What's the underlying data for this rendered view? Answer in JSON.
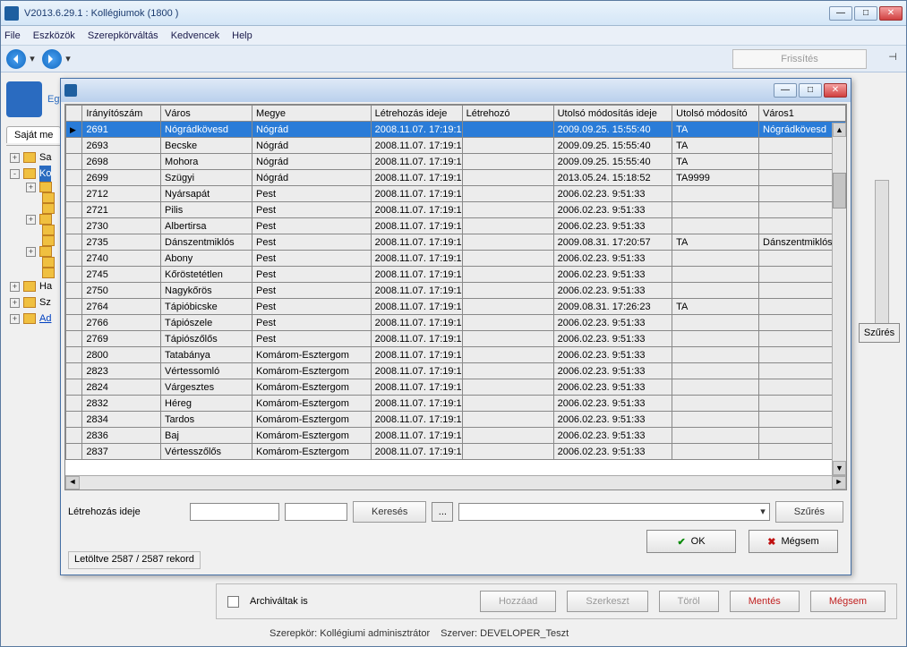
{
  "window": {
    "title": "V2013.6.29.1 : Kollégiumok (1800  )"
  },
  "menu": {
    "items": [
      "File",
      "Eszközök",
      "Szerepkörváltás",
      "Kedvencek",
      "Help"
    ]
  },
  "toolbar": {
    "refresh": "Frissítés"
  },
  "leftpane": {
    "logo_sub": "Egységes",
    "tab": "Saját me",
    "nodes": [
      "Sa",
      "Ko",
      "Ha",
      "Sz",
      "Ad"
    ]
  },
  "right": {
    "filter": "Szűrés"
  },
  "dialog": {
    "columns": [
      "Irányítószám",
      "Város",
      "Megye",
      "Létrehozás ideje",
      "Létrehozó",
      "Utolsó módosítás ideje",
      "Utolsó módosító",
      "Város1"
    ],
    "rows": [
      {
        "zip": "2691",
        "city": "Nógrádkövesd",
        "county": "Nógrád",
        "created": "2008.11.07. 17:19:1",
        "creator": "",
        "modified": "2009.09.25. 15:55:40",
        "modifier": "TA",
        "city1": "Nógrádkövesd",
        "sel": true
      },
      {
        "zip": "2693",
        "city": "Becske",
        "county": "Nógrád",
        "created": "2008.11.07. 17:19:1",
        "creator": "",
        "modified": "2009.09.25. 15:55:40",
        "modifier": "TA",
        "city1": ""
      },
      {
        "zip": "2698",
        "city": "Mohora",
        "county": "Nógrád",
        "created": "2008.11.07. 17:19:1",
        "creator": "",
        "modified": "2009.09.25. 15:55:40",
        "modifier": "TA",
        "city1": ""
      },
      {
        "zip": "2699",
        "city": "Szügyi",
        "county": "Nógrád",
        "created": "2008.11.07. 17:19:1",
        "creator": "",
        "modified": "2013.05.24. 15:18:52",
        "modifier": "TA9999",
        "city1": ""
      },
      {
        "zip": "2712",
        "city": "Nyársapát",
        "county": "Pest",
        "created": "2008.11.07. 17:19:1",
        "creator": "",
        "modified": "2006.02.23. 9:51:33",
        "modifier": "",
        "city1": ""
      },
      {
        "zip": "2721",
        "city": "Pilis",
        "county": "Pest",
        "created": "2008.11.07. 17:19:1",
        "creator": "",
        "modified": "2006.02.23. 9:51:33",
        "modifier": "",
        "city1": ""
      },
      {
        "zip": "2730",
        "city": "Albertirsa",
        "county": "Pest",
        "created": "2008.11.07. 17:19:1",
        "creator": "",
        "modified": "2006.02.23. 9:51:33",
        "modifier": "",
        "city1": ""
      },
      {
        "zip": "2735",
        "city": "Dánszentmiklós",
        "county": "Pest",
        "created": "2008.11.07. 17:19:1",
        "creator": "",
        "modified": "2009.08.31. 17:20:57",
        "modifier": "TA",
        "city1": "Dánszentmiklós"
      },
      {
        "zip": "2740",
        "city": "Abony",
        "county": "Pest",
        "created": "2008.11.07. 17:19:1",
        "creator": "",
        "modified": "2006.02.23. 9:51:33",
        "modifier": "",
        "city1": ""
      },
      {
        "zip": "2745",
        "city": "Kőröstetétlen",
        "county": "Pest",
        "created": "2008.11.07. 17:19:1",
        "creator": "",
        "modified": "2006.02.23. 9:51:33",
        "modifier": "",
        "city1": ""
      },
      {
        "zip": "2750",
        "city": "Nagykőrös",
        "county": "Pest",
        "created": "2008.11.07. 17:19:1",
        "creator": "",
        "modified": "2006.02.23. 9:51:33",
        "modifier": "",
        "city1": ""
      },
      {
        "zip": "2764",
        "city": "Tápióbicske",
        "county": "Pest",
        "created": "2008.11.07. 17:19:1",
        "creator": "",
        "modified": "2009.08.31. 17:26:23",
        "modifier": "TA",
        "city1": ""
      },
      {
        "zip": "2766",
        "city": "Tápiószele",
        "county": "Pest",
        "created": "2008.11.07. 17:19:1",
        "creator": "",
        "modified": "2006.02.23. 9:51:33",
        "modifier": "",
        "city1": ""
      },
      {
        "zip": "2769",
        "city": "Tápiószőlős",
        "county": "Pest",
        "created": "2008.11.07. 17:19:1",
        "creator": "",
        "modified": "2006.02.23. 9:51:33",
        "modifier": "",
        "city1": ""
      },
      {
        "zip": "2800",
        "city": "Tatabánya",
        "county": "Komárom-Esztergom",
        "created": "2008.11.07. 17:19:1",
        "creator": "",
        "modified": "2006.02.23. 9:51:33",
        "modifier": "",
        "city1": ""
      },
      {
        "zip": "2823",
        "city": "Vértessomló",
        "county": "Komárom-Esztergom",
        "created": "2008.11.07. 17:19:1",
        "creator": "",
        "modified": "2006.02.23. 9:51:33",
        "modifier": "",
        "city1": ""
      },
      {
        "zip": "2824",
        "city": "Várgesztes",
        "county": "Komárom-Esztergom",
        "created": "2008.11.07. 17:19:1",
        "creator": "",
        "modified": "2006.02.23. 9:51:33",
        "modifier": "",
        "city1": ""
      },
      {
        "zip": "2832",
        "city": "Héreg",
        "county": "Komárom-Esztergom",
        "created": "2008.11.07. 17:19:1",
        "creator": "",
        "modified": "2006.02.23. 9:51:33",
        "modifier": "",
        "city1": ""
      },
      {
        "zip": "2834",
        "city": "Tardos",
        "county": "Komárom-Esztergom",
        "created": "2008.11.07. 17:19:1",
        "creator": "",
        "modified": "2006.02.23. 9:51:33",
        "modifier": "",
        "city1": ""
      },
      {
        "zip": "2836",
        "city": "Baj",
        "county": "Komárom-Esztergom",
        "created": "2008.11.07. 17:19:1",
        "creator": "",
        "modified": "2006.02.23. 9:51:33",
        "modifier": "",
        "city1": ""
      },
      {
        "zip": "2837",
        "city": "Vértesszőlős",
        "county": "Komárom-Esztergom",
        "created": "2008.11.07. 17:19:1",
        "creator": "",
        "modified": "2006.02.23. 9:51:33",
        "modifier": "",
        "city1": ""
      }
    ],
    "search_label": "Létrehozás ideje",
    "search_btn": "Keresés",
    "ellipsis": "...",
    "filter_btn": "Szűrés",
    "ok": "OK",
    "cancel": "Mégsem",
    "status": "Letöltve 2587 / 2587 rekord"
  },
  "bottom": {
    "archived_label": "Archiváltak is",
    "add": "Hozzáad",
    "edit": "Szerkeszt",
    "delete": "Töröl",
    "save": "Mentés",
    "cancel": "Mégsem"
  },
  "status": {
    "role": "Szerepkör: Kollégiumi adminisztrátor",
    "server": "Szerver: DEVELOPER_Teszt"
  }
}
